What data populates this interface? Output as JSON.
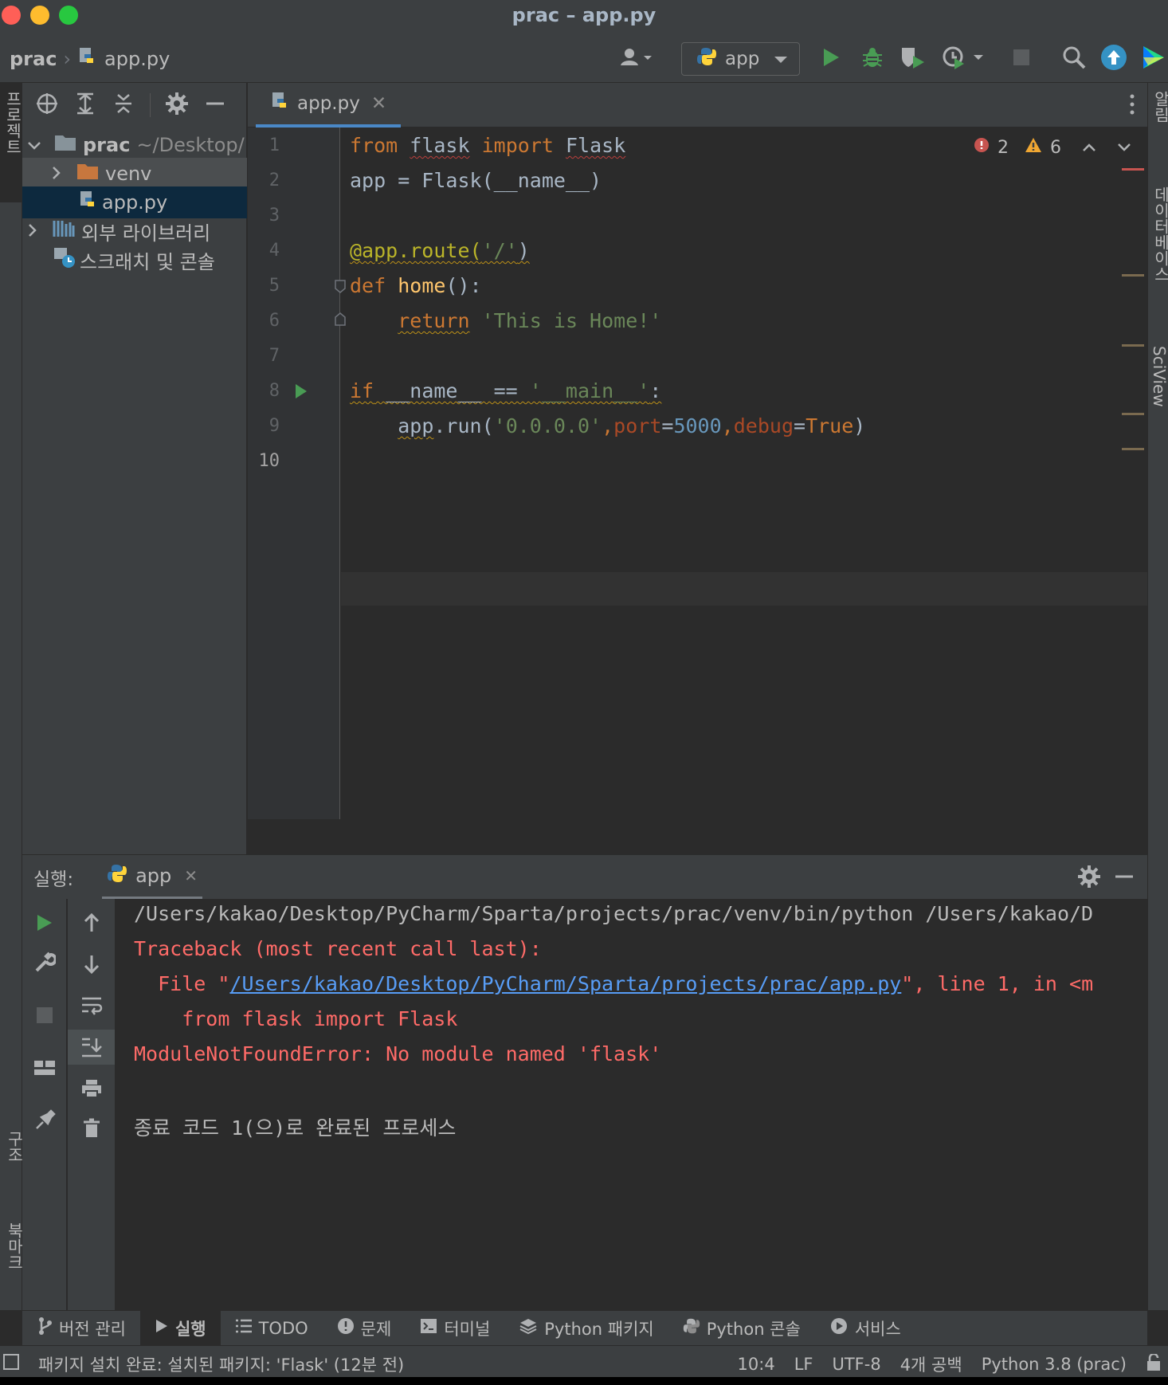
{
  "window": {
    "title": "prac – app.py"
  },
  "toolbar": {
    "breadcrumb_project": "prac",
    "breadcrumb_file": "app.py",
    "run_config": "app"
  },
  "project": {
    "root_name": "prac",
    "root_path": "~/Desktop/",
    "items": [
      {
        "label": "venv"
      },
      {
        "label": "app.py"
      },
      {
        "label": "외부 라이브러리"
      },
      {
        "label": "스크래치 및 콘솔"
      }
    ]
  },
  "left_strip": {
    "project_label": "프로젝트",
    "structure_label": "구조",
    "bookmarks_label": "북마크"
  },
  "right_strip": {
    "notifications_label": "알림",
    "database_label": "데이터베이스",
    "sciview_label": "SciView"
  },
  "editor": {
    "tab_label": "app.py",
    "errors": "2",
    "warnings": "6",
    "line_numbers": [
      "1",
      "2",
      "3",
      "4",
      "5",
      "6",
      "7",
      "8",
      "9",
      "10"
    ]
  },
  "run_panel": {
    "label": "실행:",
    "tab": "app",
    "console": {
      "line1": "/Users/kakao/Desktop/PyCharm/Sparta/projects/prac/venv/bin/python /Users/kakao/D",
      "line2": "Traceback (most recent call last):",
      "line3_prefix": "  File \"",
      "line3_link": "/Users/kakao/Desktop/PyCharm/Sparta/projects/prac/app.py",
      "line3_suffix": "\", line 1, in <m",
      "line4": "    from flask import Flask",
      "line5": "ModuleNotFoundError: No module named 'flask'",
      "line6": "종료 코드 1(으)로 완료된 프로세스"
    }
  },
  "bottom_tools": {
    "vcs": "버전 관리",
    "run": "실행",
    "todo": "TODO",
    "problems": "문제",
    "terminal": "터미널",
    "packages": "Python 패키지",
    "console": "Python 콘솔",
    "services": "서비스"
  },
  "status": {
    "message": "패키지 설치 완료: 설치된 패키지: 'Flask' (12분 전)",
    "position": "10:4",
    "line_sep": "LF",
    "encoding": "UTF-8",
    "indent": "4개 공백",
    "interpreter": "Python 3.8 (prac)"
  },
  "colors": {
    "accent": "#4a88c7",
    "error": "#ff6b68",
    "run_green": "#499c54"
  }
}
